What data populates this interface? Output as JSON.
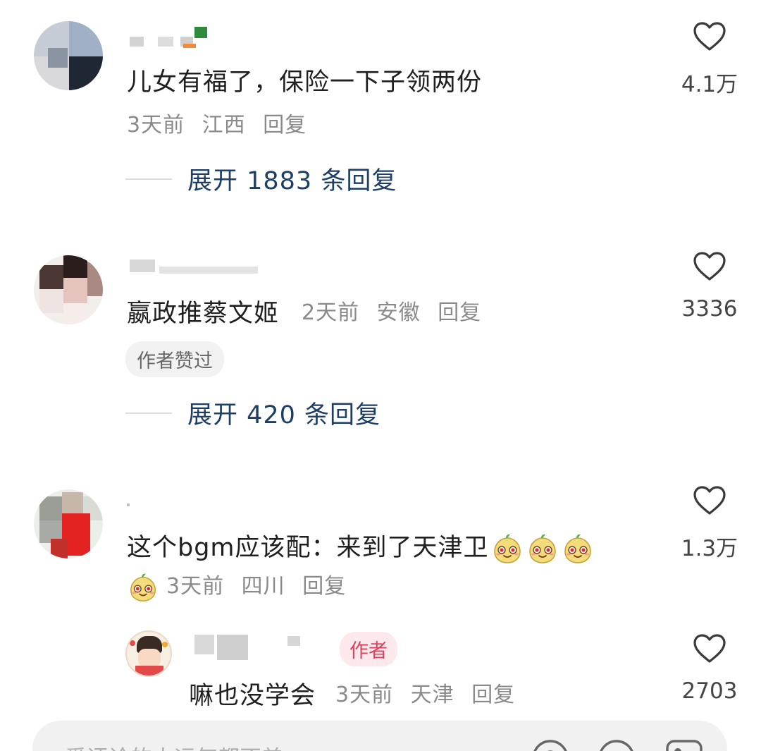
{
  "comments": [
    {
      "text": "儿女有福了，保险一下子领两份",
      "time": "3天前",
      "location": "江西",
      "reply_label": "回复",
      "likes": "4.1万",
      "expand_label": "展开 1883 条回复"
    },
    {
      "text": "嬴政推蔡文姬",
      "time": "2天前",
      "location": "安徽",
      "reply_label": "回复",
      "likes": "3336",
      "badge": "作者赞过",
      "expand_label": "展开 420 条回复"
    },
    {
      "text": "这个bgm应该配：来到了天津卫",
      "time": "3天前",
      "location": "四川",
      "reply_label": "回复",
      "likes": "1.3万",
      "reply": {
        "author_badge": "作者",
        "text": "嘛也没学会",
        "time": "3天前",
        "location": "天津",
        "reply_label": "回复",
        "likes": "2703"
      }
    }
  ],
  "input": {
    "placeholder": "爱评论的人运气都不差"
  },
  "icons": [
    "heart-outline-icon",
    "cute-face-emoji",
    "at-icon",
    "emoji-icon",
    "image-icon"
  ],
  "colors": {
    "link_blue": "#1d3e66",
    "meta_gray": "#8a8a8a",
    "author_red": "#e0405e"
  }
}
